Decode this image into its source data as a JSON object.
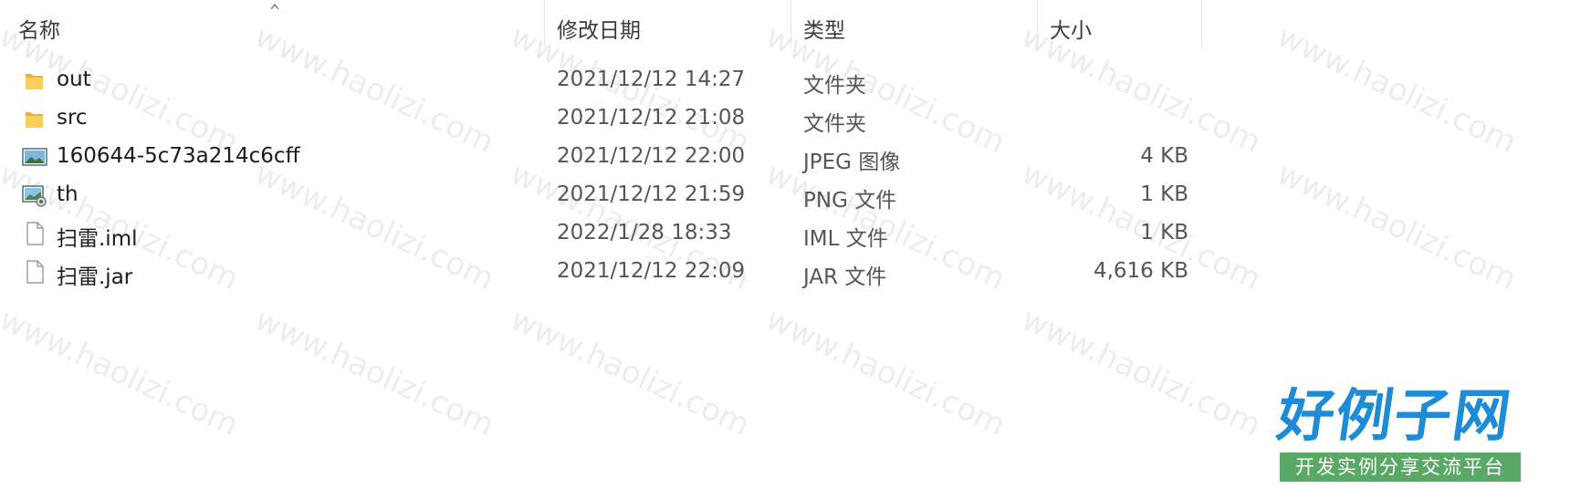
{
  "header": {
    "columns": [
      {
        "label": "名称"
      },
      {
        "label": "修改日期"
      },
      {
        "label": "类型"
      },
      {
        "label": "大小"
      }
    ]
  },
  "files": [
    {
      "icon": "folder-icon",
      "name": "out",
      "date": "2021/12/12 14:27",
      "type": "文件夹",
      "size": ""
    },
    {
      "icon": "folder-icon",
      "name": "src",
      "date": "2021/12/12 21:08",
      "type": "文件夹",
      "size": ""
    },
    {
      "icon": "jpeg-image-icon",
      "name": "160644-5c73a214c6cff",
      "date": "2021/12/12 22:00",
      "type": "JPEG 图像",
      "size": "4 KB"
    },
    {
      "icon": "png-image-icon",
      "name": "th",
      "date": "2021/12/12 21:59",
      "type": "PNG 文件",
      "size": "1 KB"
    },
    {
      "icon": "file-icon",
      "name": "扫雷.iml",
      "date": "2022/1/28 18:33",
      "type": "IML 文件",
      "size": "1 KB"
    },
    {
      "icon": "file-icon",
      "name": "扫雷.jar",
      "date": "2021/12/12 22:09",
      "type": "JAR 文件",
      "size": "4,616 KB"
    }
  ],
  "watermark": {
    "text": "www.haolizi.com"
  },
  "logo": {
    "main": "好例子网",
    "sub": "开发实例分享交流平台"
  },
  "colors": {
    "logo_blue": "#1e8bd6",
    "logo_green": "#5aa865",
    "folder": "#f4c542"
  }
}
